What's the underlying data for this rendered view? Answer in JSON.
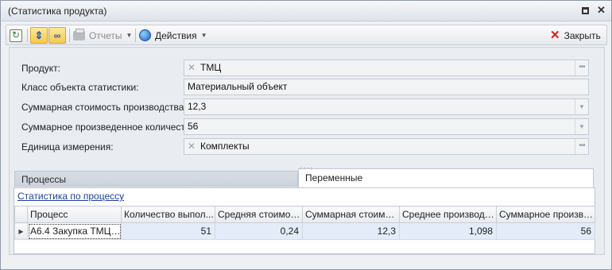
{
  "window": {
    "title": "(Статистика продукта)"
  },
  "toolbar": {
    "reports_label": "Отчеты",
    "actions_label": "Действия",
    "close_label": "Закрыть"
  },
  "form": {
    "product_label": "Продукт:",
    "product_value": "ТМЦ",
    "class_label": "Класс объекта статистики:",
    "class_value": "Материальный объект",
    "total_cost_label": "Суммарная стоимость производства:",
    "total_cost_value": "12,3",
    "total_qty_label": "Суммарное произведенное количество:",
    "total_qty_value": "56",
    "unit_label": "Единица измерения:",
    "unit_value": "Комплекты"
  },
  "tabs": {
    "processes": "Процессы",
    "variables": "Переменные"
  },
  "process_panel": {
    "link": "Статистика по процессу",
    "columns": [
      "Процесс",
      "Количество выпол...",
      "Средняя стоимос...",
      "Суммарная стоимос...",
      "Среднее производи...",
      "Суммарное произве..."
    ],
    "rows": [
      [
        "A6.4 Закупка ТМЦ ...",
        "51",
        "0,24",
        "12,3",
        "1,098",
        "56"
      ]
    ]
  }
}
